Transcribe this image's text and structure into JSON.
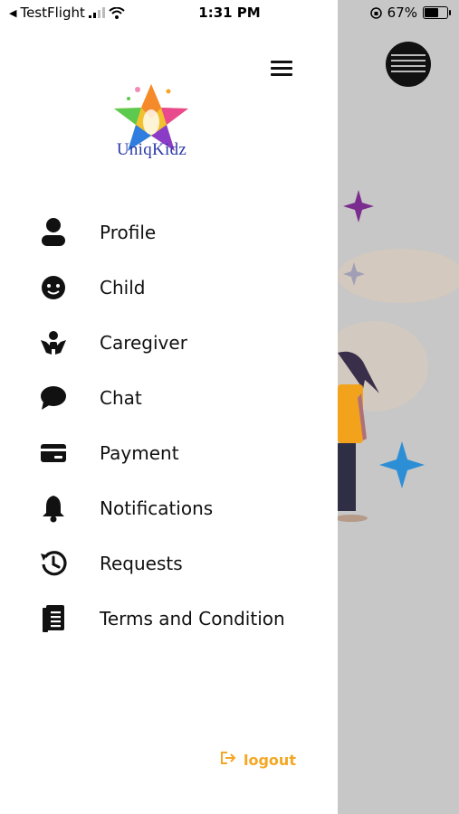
{
  "status_bar": {
    "back_app": "TestFlight",
    "time": "1:31 PM",
    "battery": "67%"
  },
  "logo": {
    "text": "UniqKidz"
  },
  "menu": {
    "items": [
      {
        "label": "Profile",
        "icon": "person-icon"
      },
      {
        "label": "Child",
        "icon": "child-face-icon"
      },
      {
        "label": "Caregiver",
        "icon": "caregiver-hands-icon"
      },
      {
        "label": "Chat",
        "icon": "chat-bubble-icon"
      },
      {
        "label": "Payment",
        "icon": "credit-card-icon"
      },
      {
        "label": "Notifications",
        "icon": "bell-icon"
      },
      {
        "label": "Requests",
        "icon": "history-icon"
      },
      {
        "label": "Terms and Condition",
        "icon": "document-icon"
      }
    ]
  },
  "logout": {
    "label": "logout",
    "icon": "logout-icon"
  },
  "colors": {
    "accent": "#f5a623",
    "brand_text": "#2d3aa8",
    "overlay": "#c7c7c7"
  }
}
